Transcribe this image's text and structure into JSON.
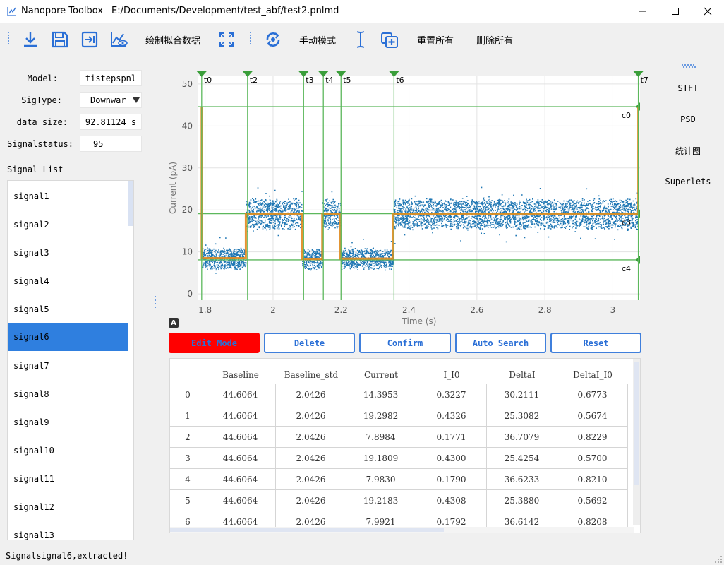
{
  "window": {
    "app_name": "Nanopore Toolbox",
    "file_path": "E:/Documents/Development/test_abf/test2.pnlmd"
  },
  "toolbar": {
    "plot_fit_label": "绘制拟合数据",
    "manual_mode_label": "手动模式",
    "reset_all_label": "重置所有",
    "delete_all_label": "删除所有",
    "icons": [
      "download-icon",
      "save-icon",
      "import-icon",
      "chart-view-icon",
      "expand-icon",
      "refresh-icon",
      "cursor-icon",
      "add-window-icon"
    ]
  },
  "form": {
    "model_label": "Model:",
    "model_value": "tistepspnl",
    "sigtype_label": "SigType:",
    "sigtype_value": "Downwar",
    "datasize_label": "data size:",
    "datasize_value": "92.81124 s",
    "signalstatus_label": "Signalstatus:",
    "signalstatus_value": "95"
  },
  "signal_list": {
    "title": "Signal List",
    "items": [
      "signal1",
      "signal2",
      "signal3",
      "signal4",
      "signal5",
      "signal6",
      "signal7",
      "signal8",
      "signal9",
      "signal10",
      "signal11",
      "signal12",
      "signal13"
    ],
    "selected": "signal6"
  },
  "chart_data": {
    "type": "scatter",
    "xlabel": "Time (s)",
    "ylabel": "Current (pA)",
    "xlim": [
      1.78,
      3.08
    ],
    "ylim": [
      -1.5,
      52
    ],
    "xticks": [
      "1.8",
      "2",
      "2.2",
      "2.4",
      "2.6",
      "2.8",
      "3"
    ],
    "yticks": [
      "0",
      "10",
      "20",
      "30",
      "40",
      "50"
    ],
    "grid": true,
    "scatter_color": "#1f77b4",
    "fit_color": "#e08a1e",
    "marker_color": "#5cb85c",
    "fit_segments": [
      {
        "x0": 1.79,
        "x1": 1.92,
        "y": 8.5
      },
      {
        "x0": 1.92,
        "x1": 2.085,
        "y": 19.1
      },
      {
        "x0": 2.085,
        "x1": 2.145,
        "y": 8.3
      },
      {
        "x0": 2.145,
        "x1": 2.198,
        "y": 19.1
      },
      {
        "x0": 2.198,
        "x1": 2.353,
        "y": 8.4
      },
      {
        "x0": 2.353,
        "x1": 3.075,
        "y": 19.1
      }
    ],
    "time_markers": [
      {
        "label": "t0",
        "x": 1.79
      },
      {
        "label": "t2",
        "x": 1.925
      },
      {
        "label": "t3",
        "x": 2.09
      },
      {
        "label": "t4",
        "x": 2.148
      },
      {
        "label": "t5",
        "x": 2.2
      },
      {
        "label": "t6",
        "x": 2.356
      },
      {
        "label": "t7",
        "x": 3.075
      }
    ],
    "level_markers": [
      {
        "label": "c0",
        "y": 44.6
      },
      {
        "label": "c3",
        "y": 19.1
      },
      {
        "label": "c4",
        "y": 8.1
      }
    ]
  },
  "badge_label": "A",
  "actions": {
    "edit_mode": "Edit Mode",
    "delete": "Delete",
    "confirm": "Confirm",
    "auto_search": "Auto Search",
    "reset": "Reset"
  },
  "table": {
    "columns": [
      "Baseline",
      "Baseline_std",
      "Current",
      "I_I0",
      "DeltaI",
      "DeltaI_I0"
    ],
    "rows": [
      {
        "index": "0",
        "cells": [
          "44.6064",
          "2.0426",
          "14.3953",
          "0.3227",
          "30.2111",
          "0.6773"
        ]
      },
      {
        "index": "1",
        "cells": [
          "44.6064",
          "2.0426",
          "19.2982",
          "0.4326",
          "25.3082",
          "0.5674"
        ]
      },
      {
        "index": "2",
        "cells": [
          "44.6064",
          "2.0426",
          "7.8984",
          "0.1771",
          "36.7079",
          "0.8229"
        ]
      },
      {
        "index": "3",
        "cells": [
          "44.6064",
          "2.0426",
          "19.1809",
          "0.4300",
          "25.4254",
          "0.5700"
        ]
      },
      {
        "index": "4",
        "cells": [
          "44.6064",
          "2.0426",
          "7.9830",
          "0.1790",
          "36.6233",
          "0.8210"
        ]
      },
      {
        "index": "5",
        "cells": [
          "44.6064",
          "2.0426",
          "19.2183",
          "0.4308",
          "25.3880",
          "0.5692"
        ]
      },
      {
        "index": "6",
        "cells": [
          "44.6064",
          "2.0426",
          "7.9921",
          "0.1792",
          "36.6142",
          "0.8208"
        ]
      }
    ]
  },
  "side_panel": {
    "items": [
      "STFT",
      "PSD",
      "统计图",
      "Superlets"
    ]
  },
  "status": {
    "text": "Signalsignal6,extracted!"
  }
}
